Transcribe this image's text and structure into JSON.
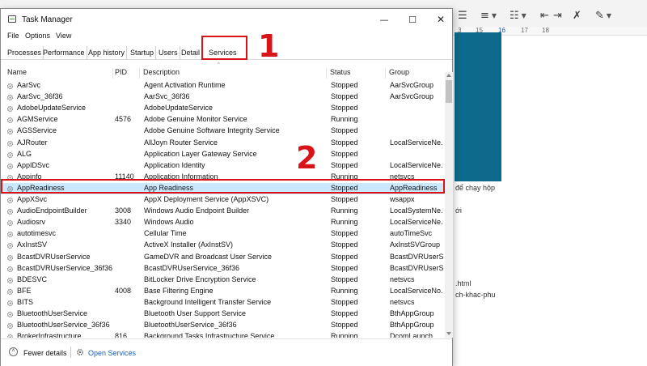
{
  "window": {
    "title": "Task Manager",
    "controls": {
      "minimize": "—",
      "maximize": "☐",
      "close": "✕"
    }
  },
  "menu": [
    "File",
    "Options",
    "View"
  ],
  "tabs": [
    "Processes",
    "Performance",
    "App history",
    "Startup",
    "Users",
    "Detail",
    "Services"
  ],
  "active_tab": "Services",
  "annotations": {
    "step1": "1",
    "step2": "2"
  },
  "columns": {
    "name": "Name",
    "pid": "PID",
    "description": "Description",
    "status": "Status",
    "group": "Group"
  },
  "services": [
    {
      "name": "AarSvc",
      "pid": "",
      "description": "Agent Activation Runtime",
      "status": "Stopped",
      "group": "AarSvcGroup"
    },
    {
      "name": "AarSvc_36f36",
      "pid": "",
      "description": "AarSvc_36f36",
      "status": "Stopped",
      "group": "AarSvcGroup"
    },
    {
      "name": "AdobeUpdateService",
      "pid": "",
      "description": "AdobeUpdateService",
      "status": "Stopped",
      "group": ""
    },
    {
      "name": "AGMService",
      "pid": "4576",
      "description": "Adobe Genuine Monitor Service",
      "status": "Running",
      "group": ""
    },
    {
      "name": "AGSService",
      "pid": "",
      "description": "Adobe Genuine Software Integrity Service",
      "status": "Stopped",
      "group": ""
    },
    {
      "name": "AJRouter",
      "pid": "",
      "description": "AllJoyn Router Service",
      "status": "Stopped",
      "group": "LocalServiceNe..."
    },
    {
      "name": "ALG",
      "pid": "",
      "description": "Application Layer Gateway Service",
      "status": "Stopped",
      "group": ""
    },
    {
      "name": "AppIDSvc",
      "pid": "",
      "description": "Application Identity",
      "status": "Stopped",
      "group": "LocalServiceNe..."
    },
    {
      "name": "Appinfo",
      "pid": "11140",
      "description": "Application Information",
      "status": "Running",
      "group": "netsvcs"
    },
    {
      "name": "AppReadiness",
      "pid": "",
      "description": "App Readiness",
      "status": "Stopped",
      "group": "AppReadiness"
    },
    {
      "name": "AppXSvc",
      "pid": "",
      "description": "AppX Deployment Service (AppXSVC)",
      "status": "Stopped",
      "group": "wsappx"
    },
    {
      "name": "AudioEndpointBuilder",
      "pid": "3008",
      "description": "Windows Audio Endpoint Builder",
      "status": "Running",
      "group": "LocalSystemNe..."
    },
    {
      "name": "Audiosrv",
      "pid": "3340",
      "description": "Windows Audio",
      "status": "Running",
      "group": "LocalServiceNe..."
    },
    {
      "name": "autotimesvc",
      "pid": "",
      "description": "Cellular Time",
      "status": "Stopped",
      "group": "autoTimeSvc"
    },
    {
      "name": "AxInstSV",
      "pid": "",
      "description": "ActiveX Installer (AxInstSV)",
      "status": "Stopped",
      "group": "AxInstSVGroup"
    },
    {
      "name": "BcastDVRUserService",
      "pid": "",
      "description": "GameDVR and Broadcast User Service",
      "status": "Stopped",
      "group": "BcastDVRUserS..."
    },
    {
      "name": "BcastDVRUserService_36f36",
      "pid": "",
      "description": "BcastDVRUserService_36f36",
      "status": "Stopped",
      "group": "BcastDVRUserS..."
    },
    {
      "name": "BDESVC",
      "pid": "",
      "description": "BitLocker Drive Encryption Service",
      "status": "Stopped",
      "group": "netsvcs"
    },
    {
      "name": "BFE",
      "pid": "4008",
      "description": "Base Filtering Engine",
      "status": "Running",
      "group": "LocalServiceNo..."
    },
    {
      "name": "BITS",
      "pid": "",
      "description": "Background Intelligent Transfer Service",
      "status": "Stopped",
      "group": "netsvcs"
    },
    {
      "name": "BluetoothUserService",
      "pid": "",
      "description": "Bluetooth User Support Service",
      "status": "Stopped",
      "group": "BthAppGroup"
    },
    {
      "name": "BluetoothUserService_36f36",
      "pid": "",
      "description": "BluetoothUserService_36f36",
      "status": "Stopped",
      "group": "BthAppGroup"
    },
    {
      "name": "BrokerInfrastructure",
      "pid": "816",
      "description": "Background Tasks Infrastructure Service",
      "status": "Running",
      "group": "DcomLaunch"
    }
  ],
  "selected_service": "AppReadiness",
  "footer": {
    "fewer_details": "Fewer details",
    "open_services": "Open Services"
  },
  "background_doc": {
    "ruler": [
      "15",
      "16",
      "17",
      "18"
    ],
    "text_lines": [
      "để chạy hộp",
      "ới",
      ".html",
      "ch-khac-phu"
    ]
  },
  "colors": {
    "callout": "#d81418",
    "selection": "#cce8ff",
    "link": "#1a5fb4"
  }
}
